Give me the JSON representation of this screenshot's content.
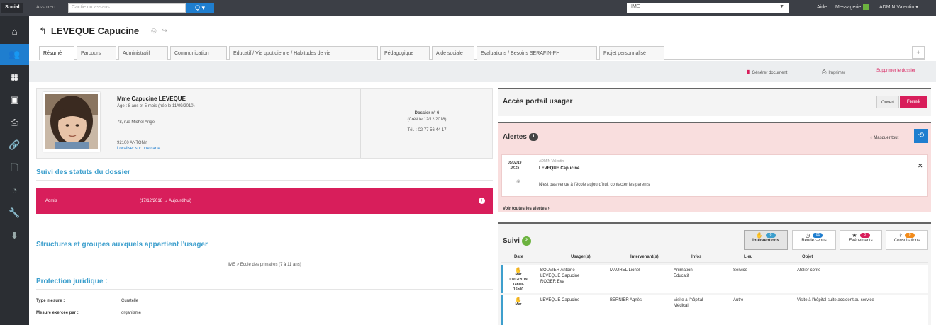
{
  "topbar": {
    "social": "Social",
    "associations": "Assoxeo",
    "search_placeholder": "Cactie ou assaus",
    "search_button": "Q",
    "establishment": "IME",
    "aide": "Aide",
    "messagerie": "Messagerie",
    "user": "ADMIN Valentin"
  },
  "sidebar": [
    {
      "icon": "home-icon",
      "glyph": "⌂"
    },
    {
      "icon": "users-icon",
      "glyph": "👥"
    },
    {
      "icon": "calendar-icon",
      "glyph": "▦"
    },
    {
      "icon": "book-icon",
      "glyph": "▣"
    },
    {
      "icon": "print-icon",
      "glyph": "⎙"
    },
    {
      "icon": "link-icon",
      "glyph": "🔗"
    },
    {
      "icon": "document-icon",
      "glyph": "🗋"
    },
    {
      "icon": "chart-icon",
      "glyph": "◔"
    },
    {
      "icon": "wrench-icon",
      "glyph": "🔧"
    },
    {
      "icon": "download-icon",
      "glyph": "⬇"
    }
  ],
  "person": {
    "name": "LEVEQUE Capucine"
  },
  "tabs": [
    "Résumé",
    "Parcours",
    "Administratif",
    "Communication",
    "Educatif / Vie quotidienne / Habitudes de vie",
    "Pédagogique",
    "Aide sociale",
    "Evaluations / Besoins SERAFIN-PH",
    "Projet personnalisé"
  ],
  "actions": {
    "generate": "Générer document",
    "print": "Imprimer",
    "delete": "Supprimer le dossier"
  },
  "card": {
    "name": "Mme Capucine LEVEQUE",
    "age": "Âge : 8 ans et 5 mois (née le 11/09/2010)",
    "address": "78, rue Michel Ange",
    "city": "92100 ANTONY",
    "locate": "Localiser sur une carte",
    "dossier": "Dossier n° 6",
    "created": "(Créé le 12/12/2018)",
    "tel": "Tél. : 02 77 56 44 17"
  },
  "suivi_statuts": {
    "title": "Suivi des statuts du dossier",
    "status": "Admis",
    "period": "(17/12/2018 → Aujourd'hui)"
  },
  "structures": {
    "title": "Structures et groupes auxquels appartient l'usager",
    "value": "IME > Ecole des primaires (7 à 11 ans)"
  },
  "protection": {
    "title": "Protection juridique :",
    "type_label": "Type mesure :",
    "type_value": "Curatelle",
    "by_label": "Mesure exercée par :",
    "by_value": "organisme"
  },
  "portal": {
    "title": "Accès portail usager",
    "open": "Ouvert",
    "closed": "Fermé"
  },
  "alerts": {
    "title": "Alertes",
    "count": "1",
    "hide_all": "Masquer tout",
    "date": "05/02/19",
    "time": "10:25",
    "author": "ADMIN Valentin",
    "person": "LEVEQUE Capucine",
    "message": "N'est pas venue à l'école aujourd'hui, contacter les parents",
    "see_all": "Voir toutes les alertes ›"
  },
  "suivi": {
    "title": "Suivi",
    "count": "2",
    "filters": [
      {
        "label": "Interventions",
        "count": "0",
        "color": "#3d9fcd",
        "icon": "hand-icon",
        "glyph": "✋"
      },
      {
        "label": "Rendez-vous",
        "count": "01",
        "color": "#1f7ecf",
        "icon": "clock-icon",
        "glyph": "◷"
      },
      {
        "label": "Evénements",
        "count": "0",
        "color": "#d81e5b",
        "icon": "star-icon",
        "glyph": "★"
      },
      {
        "label": "Consultations",
        "count": "0",
        "color": "#f28b1a",
        "icon": "stethoscope-icon",
        "glyph": "⚕"
      }
    ],
    "columns": [
      "Date",
      "Usager(s)",
      "Intervenant(s)",
      "Infos",
      "Lieu",
      "Objet"
    ],
    "rows": [
      {
        "date": "Mar 01/02/2019",
        "time": "14h00-15h00",
        "usagers": "BOUVIER Antoine\nLEVEQUE Capucine\nROGER Eva",
        "intervenants": "MAUREL Lionel",
        "infos": "Animation\nÉducatif",
        "lieu": "Service",
        "objet": "Atelier conte"
      },
      {
        "date": "Mar",
        "time": "",
        "usagers": "LEVEQUE Capucine",
        "intervenants": "BERNIER Agnès",
        "infos": "Visite à l'hôpital\nMédical",
        "lieu": "Autre",
        "objet": "Visite à l'hôpital suite accident au service"
      }
    ]
  }
}
